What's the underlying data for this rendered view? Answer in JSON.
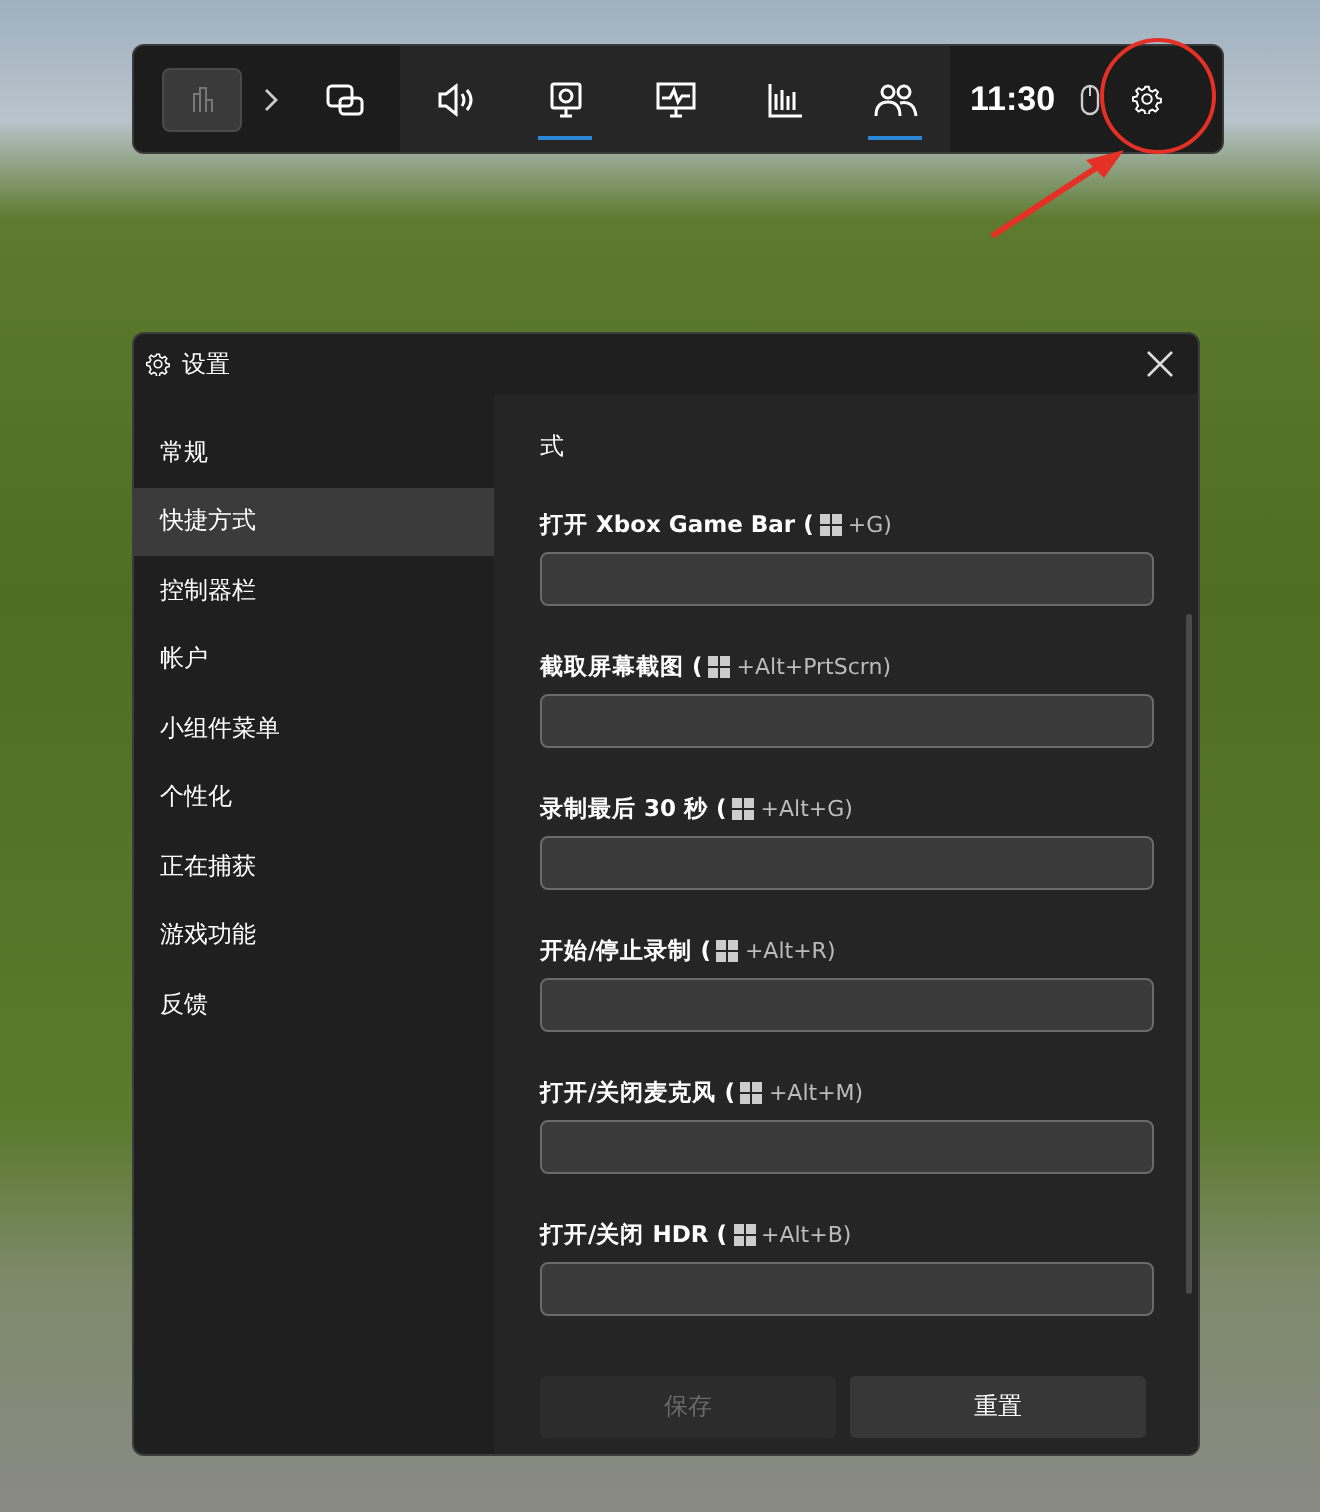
{
  "game_bar": {
    "widgets": [
      {
        "kind": "capture-widgets",
        "selected": false
      },
      {
        "kind": "audio",
        "selected": false
      },
      {
        "kind": "capture",
        "selected": true
      },
      {
        "kind": "performance",
        "selected": false
      },
      {
        "kind": "resources",
        "selected": false
      },
      {
        "kind": "social",
        "selected": true
      }
    ],
    "time": "11:30"
  },
  "settings": {
    "title": "设置",
    "nav": [
      {
        "label": "常规",
        "selected": false
      },
      {
        "label": "快捷方式",
        "selected": true
      },
      {
        "label": "控制器栏",
        "selected": false
      },
      {
        "label": "帐户",
        "selected": false
      },
      {
        "label": "小组件菜单",
        "selected": false
      },
      {
        "label": "个性化",
        "selected": false
      },
      {
        "label": "正在捕获",
        "selected": false
      },
      {
        "label": "游戏功能",
        "selected": false
      },
      {
        "label": "反馈",
        "selected": false
      }
    ],
    "intro_tail": "式",
    "shortcuts": [
      {
        "prefix": "打开 Xbox Game Bar (",
        "suffix": "+G)"
      },
      {
        "prefix": "截取屏幕截图 (",
        "suffix": "+Alt+PrtScrn)"
      },
      {
        "prefix": "录制最后 30 秒 (",
        "suffix": "+Alt+G)"
      },
      {
        "prefix": "开始/停止录制 (",
        "suffix": "+Alt+R)"
      },
      {
        "prefix": "打开/关闭麦克风 (",
        "suffix": "+Alt+M)"
      },
      {
        "prefix": "打开/关闭 HDR (",
        "suffix": "+Alt+B)"
      }
    ],
    "buttons": [
      {
        "label": "保存",
        "disabled": true
      },
      {
        "label": "重置",
        "disabled": false
      }
    ]
  }
}
